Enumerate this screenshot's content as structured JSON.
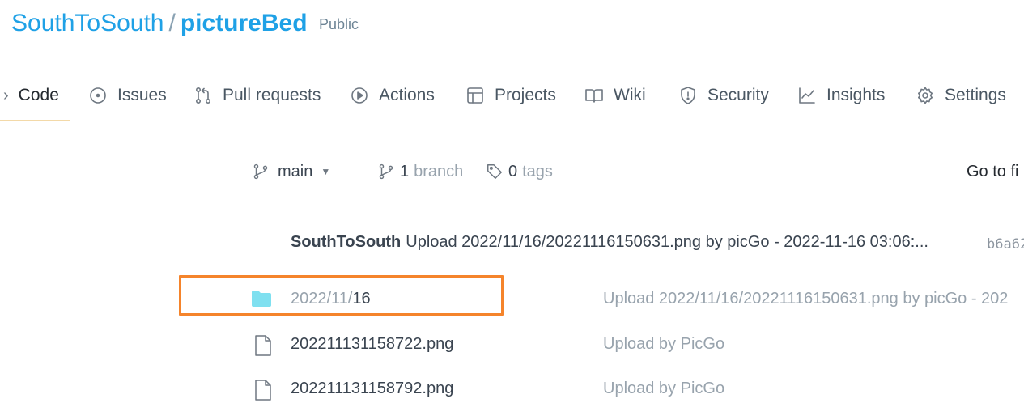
{
  "repo": {
    "owner": "SouthToSouth",
    "separator": "/",
    "name": "pictureBed",
    "visibility": "Public"
  },
  "tabs": [
    {
      "label": "Code",
      "icon": "code-icon",
      "active": true
    },
    {
      "label": "Issues",
      "icon": "issue-icon"
    },
    {
      "label": "Pull requests",
      "icon": "pull-request-icon"
    },
    {
      "label": "Actions",
      "icon": "play-icon"
    },
    {
      "label": "Projects",
      "icon": "table-icon"
    },
    {
      "label": "Wiki",
      "icon": "book-icon"
    },
    {
      "label": "Security",
      "icon": "shield-icon"
    },
    {
      "label": "Insights",
      "icon": "graph-icon"
    },
    {
      "label": "Settings",
      "icon": "gear-icon"
    }
  ],
  "branch_bar": {
    "current_branch": "main",
    "branches_count": "1",
    "branches_label": "branch",
    "tags_count": "0",
    "tags_label": "tags",
    "go_to_file": "Go to fi"
  },
  "latest_commit": {
    "author": "SouthToSouth",
    "message": "Upload 2022/11/16/20221116150631.png by picGo - 2022-11-16 03:06:...",
    "hash": "b6a62"
  },
  "files": [
    {
      "type": "folder",
      "name_muted": "2022/11/",
      "name_strong": "16",
      "commit": "Upload 2022/11/16/20221116150631.png by picGo - 202"
    },
    {
      "type": "file",
      "name": "202211131158722.png",
      "commit": "Upload by PicGo"
    },
    {
      "type": "file",
      "name": "202211131158792.png",
      "commit": "Upload by PicGo"
    }
  ],
  "colors": {
    "link": "#1fa1e6",
    "folder": "#7fe0f0",
    "highlight": "#f5842b"
  }
}
